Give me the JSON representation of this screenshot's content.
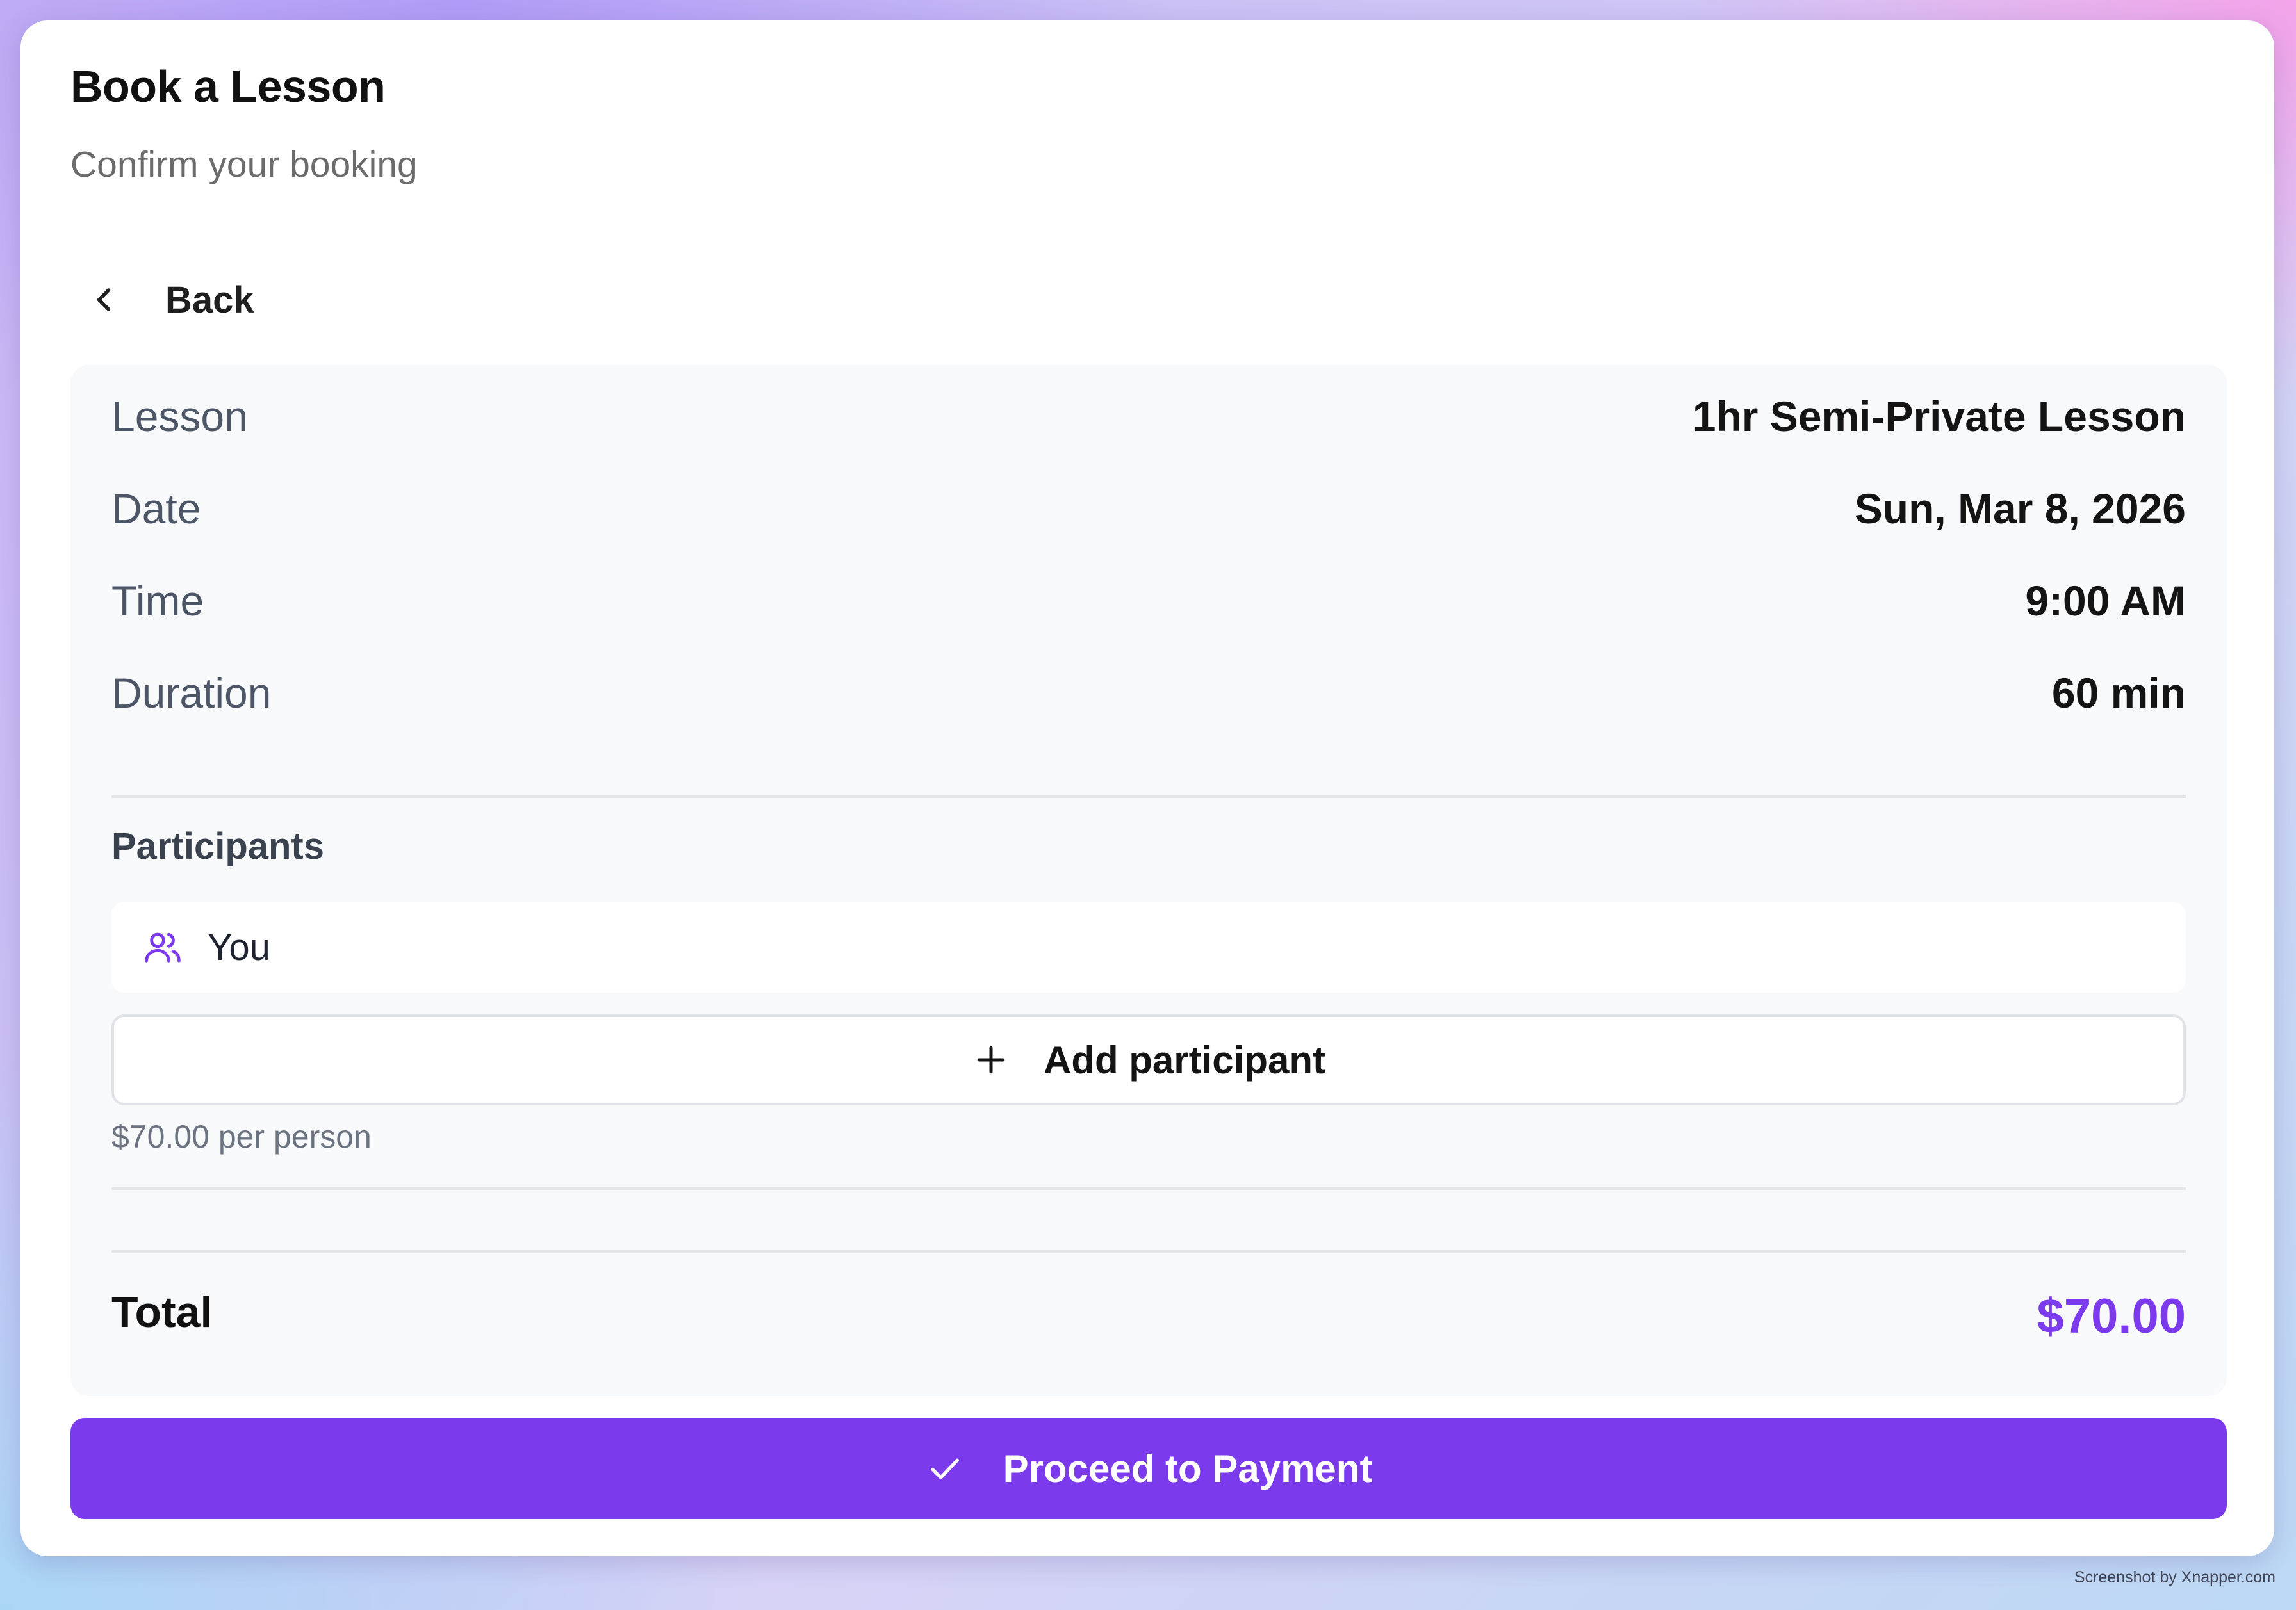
{
  "header": {
    "title": "Book a Lesson",
    "subtitle": "Confirm your booking"
  },
  "back": {
    "label": "Back",
    "icon": "chevron-left-icon"
  },
  "summary": {
    "rows": [
      {
        "key": "Lesson",
        "value": "1hr Semi-Private Lesson"
      },
      {
        "key": "Date",
        "value": "Sun, Mar 8, 2026"
      },
      {
        "key": "Time",
        "value": "9:00 AM"
      },
      {
        "key": "Duration",
        "value": "60 min"
      }
    ]
  },
  "participants": {
    "label": "Participants",
    "items": [
      {
        "name": "You",
        "icon": "users-icon"
      }
    ],
    "add_label": "Add participant",
    "add_icon": "plus-icon",
    "price_note": "$70.00 per person"
  },
  "total": {
    "label": "Total",
    "value": "$70.00"
  },
  "cta": {
    "label": "Proceed to Payment",
    "icon": "check-icon"
  },
  "watermark": "Screenshot by Xnapper.com",
  "colors": {
    "accent": "#7c3aed",
    "panel": "#f8f9fb",
    "text": "#141414",
    "muted": "#4c5667"
  }
}
